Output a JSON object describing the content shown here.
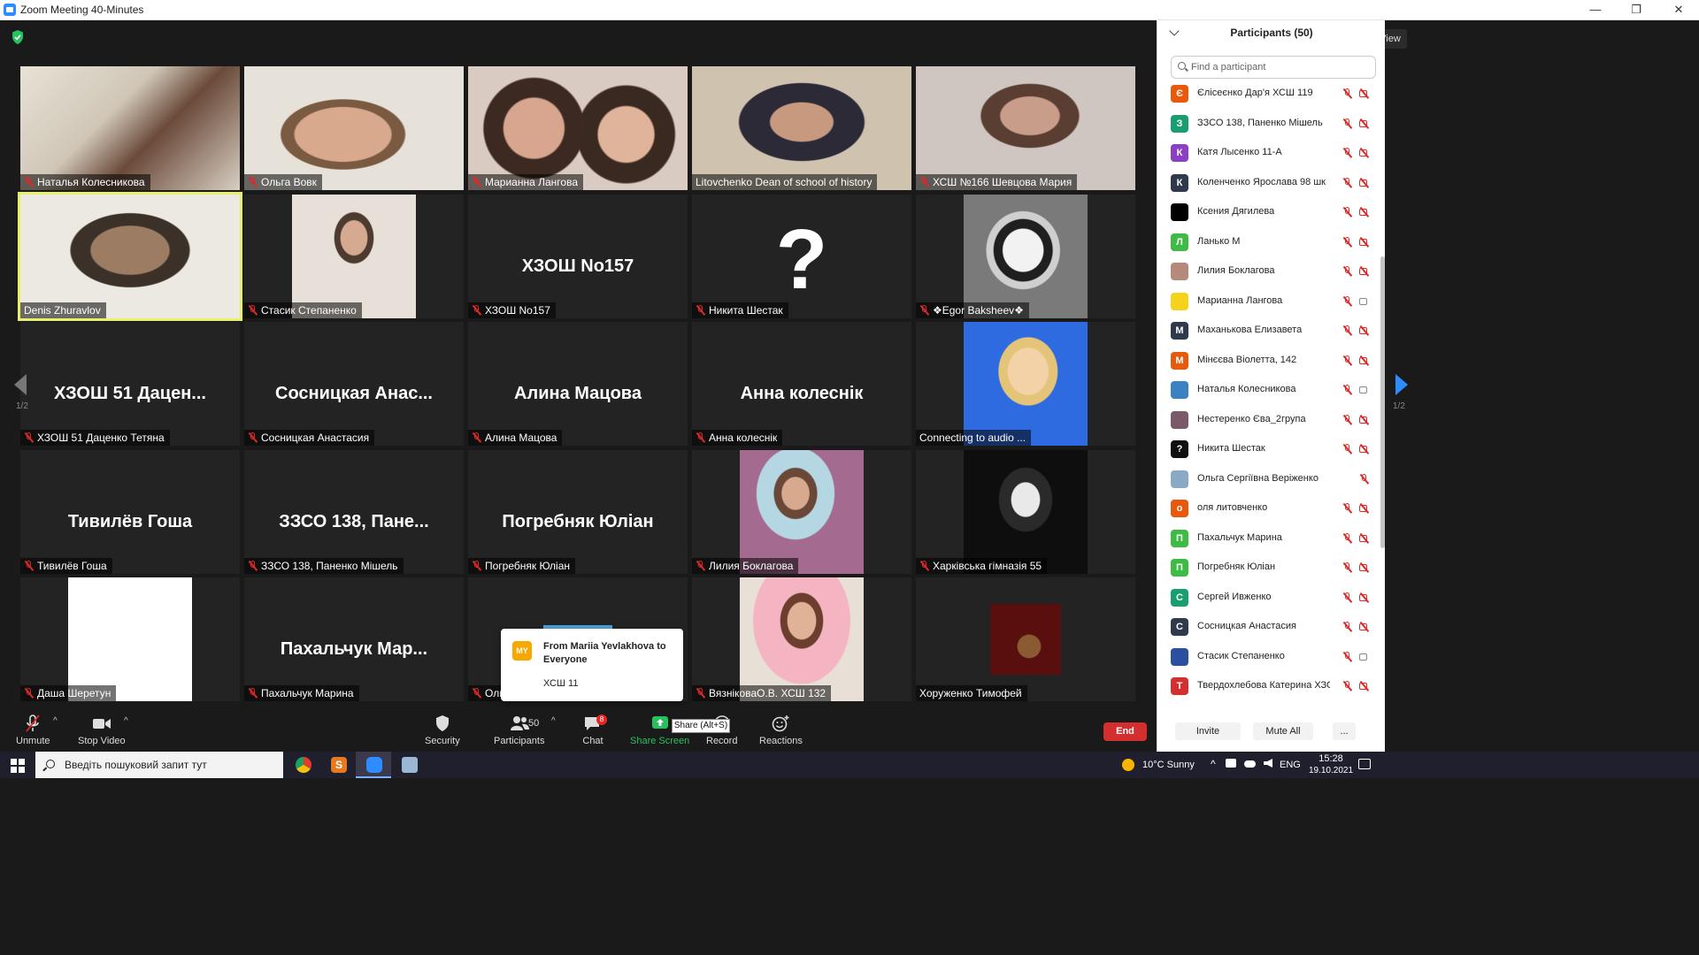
{
  "window": {
    "title": "Zoom Meeting 40-Minutes",
    "minimize": "—",
    "restore": "❐",
    "close": "✕"
  },
  "view_label": "View",
  "pager": {
    "left": "1/2",
    "right": "1/2"
  },
  "tiles": [
    {
      "label": "Наталья Колесникова",
      "muted": true,
      "kind": "v1"
    },
    {
      "label": "Ольга Вовк",
      "muted": true,
      "kind": "v2"
    },
    {
      "label": "Марианна Лангова",
      "muted": true,
      "kind": "v3"
    },
    {
      "label": "Litovchenko Dean of school of history",
      "muted": false,
      "kind": "v4"
    },
    {
      "label": "ХСШ №166 Шевцова Мария",
      "muted": true,
      "kind": "v5"
    },
    {
      "label": "Denis Zhuravlov",
      "muted": false,
      "kind": "v6",
      "active": true
    },
    {
      "label": "Стасик Степаненко",
      "muted": true,
      "kind": "v7"
    },
    {
      "label": "ХЗОШ No157",
      "muted": true,
      "big": "ХЗОШ No157"
    },
    {
      "label": "Никита Шестак",
      "muted": true,
      "big": "?"
    },
    {
      "label": "❖Egor Baksheev❖",
      "muted": true,
      "kind": "v8"
    },
    {
      "label": "ХЗОШ 51 Даценко Тетяна",
      "muted": true,
      "big": "ХЗОШ 51 Дацен..."
    },
    {
      "label": "Сосницкая Анастасия",
      "muted": true,
      "big": "Сосницкая Анас..."
    },
    {
      "label": "Алина Мацова",
      "muted": true,
      "big": "Алина Мацова"
    },
    {
      "label": "Анна колеснік",
      "muted": true,
      "big": "Анна колеснік"
    },
    {
      "label": "Connecting to audio ...",
      "muted": false,
      "kind": "v9"
    },
    {
      "label": "Тивилёв Гоша",
      "muted": true,
      "big": "Тивилёв Гоша"
    },
    {
      "label": "ЗЗСО 138, Паненко Мішель",
      "muted": true,
      "big": "ЗЗСО 138, Пане..."
    },
    {
      "label": "Погребняк Юліан",
      "muted": true,
      "big": "Погребняк Юліан"
    },
    {
      "label": "Лилия Боклагова",
      "muted": true,
      "kind": "v10"
    },
    {
      "label": "Харківська гімназія 55",
      "muted": true,
      "kind": "v11"
    },
    {
      "label": "Даша Шеретун",
      "muted": true,
      "kind": "white"
    },
    {
      "label": "Пахальчук Марина",
      "muted": true,
      "big": "Пахальчук Мар..."
    },
    {
      "label": "Оль",
      "muted": true,
      "kind": "dark"
    },
    {
      "label": "ВязніковаО.В. ХСШ 132",
      "muted": true,
      "kind": "v12"
    },
    {
      "label": "Хоруженко Тимофей",
      "muted": false,
      "kind": "v13"
    }
  ],
  "chat_popup": {
    "avatar": "MY",
    "from": "From Mariia Yevlakhova to Everyone",
    "message": "ХСШ 11"
  },
  "toolbar": {
    "unmute": "Unmute",
    "stop_video": "Stop Video",
    "security": "Security",
    "participants": "Participants",
    "participants_count": "50",
    "chat": "Chat",
    "chat_badge": "8",
    "share_screen": "Share Screen",
    "share_tooltip": "Share (Alt+S)",
    "record": "Record",
    "reactions": "Reactions",
    "end": "End"
  },
  "panel": {
    "title": "Participants (50)",
    "search_placeholder": "Find a participant",
    "invite": "Invite",
    "mute_all": "Mute All",
    "more": "...",
    "participants": [
      {
        "name": "Єлісеєнко Дар'я ХСШ 119",
        "initial": "Є",
        "color": "#e8590c",
        "cam": "off"
      },
      {
        "name": "ЗЗСО 138, Паненко Мішель",
        "initial": "З",
        "color": "#1a9e70",
        "cam": "off"
      },
      {
        "name": "Катя Лысенко 11-А",
        "initial": "К",
        "color": "#8a3fc4",
        "cam": "off"
      },
      {
        "name": "Коленченко Ярослава 98 шк",
        "initial": "К",
        "color": "#2f3a4c",
        "cam": "off"
      },
      {
        "name": "Ксения Дягилева",
        "initial": "",
        "color": "#000000",
        "cam": "off"
      },
      {
        "name": "Ланько М",
        "initial": "Л",
        "color": "#3dbb45",
        "cam": "off"
      },
      {
        "name": "Лилия Боклагова",
        "initial": "",
        "color": "#b58a7a",
        "cam": "off"
      },
      {
        "name": "Марианна Лангова",
        "initial": "",
        "color": "#f5d21c",
        "cam": "on"
      },
      {
        "name": "Маханькова Елизавета",
        "initial": "М",
        "color": "#2f3a4c",
        "cam": "off"
      },
      {
        "name": "Мінєєва Віолетта, 142",
        "initial": "М",
        "color": "#e8590c",
        "cam": "off"
      },
      {
        "name": "Наталья Колесникова",
        "initial": "",
        "color": "#3b82c4",
        "cam": "on"
      },
      {
        "name": "Нестеренко Єва_2група",
        "initial": "",
        "color": "#7a5a6a",
        "cam": "off"
      },
      {
        "name": "Никита Шестак",
        "initial": "?",
        "color": "#111111",
        "cam": "off"
      },
      {
        "name": "Ольга Сергіївна Веріженко",
        "initial": "",
        "color": "#8aa9c4",
        "cam": "hidden"
      },
      {
        "name": "оля литовченко",
        "initial": "о",
        "color": "#e8590c",
        "cam": "off"
      },
      {
        "name": "Пахальчук Марина",
        "initial": "П",
        "color": "#3dbb45",
        "cam": "off"
      },
      {
        "name": "Погребняк Юліан",
        "initial": "П",
        "color": "#3dbb45",
        "cam": "off"
      },
      {
        "name": "Сергей Ивженко",
        "initial": "С",
        "color": "#1a9e70",
        "cam": "off"
      },
      {
        "name": "Сосницкая Анастасия",
        "initial": "С",
        "color": "#2f3a4c",
        "cam": "off"
      },
      {
        "name": "Стасик Степаненко",
        "initial": "",
        "color": "#2c4fa0",
        "cam": "on"
      },
      {
        "name": "Твердохлебова Катерина ХЗО...",
        "initial": "Т",
        "color": "#d42f2f",
        "cam": "off"
      }
    ]
  },
  "taskbar": {
    "search_placeholder": "Введіть пошуковий запит тут",
    "weather": "10°C  Sunny",
    "lang": "ENG",
    "time": "15:28",
    "date": "19.10.2021"
  }
}
